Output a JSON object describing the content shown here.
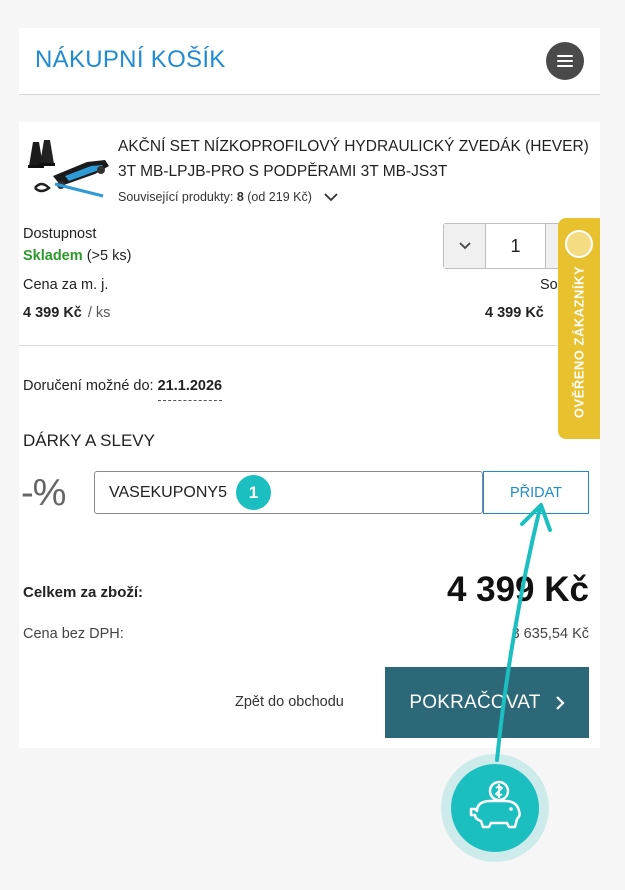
{
  "header": {
    "title": "NÁKUPNÍ KOŠÍK",
    "menu_icon": "hamburger-menu-icon"
  },
  "product": {
    "name": "AKČNÍ SET NÍZKOPROFILOVÝ HYDRAULICKÝ ZVEDÁK (HEVER) 3T MB-LPJB-PRO S PODPĚRAMI 3T MB-JS3T",
    "related_label": "Související produkty:",
    "related_count": "8",
    "related_price": "(od 219 Kč)",
    "availability_label": "Dostupnost",
    "stock_status": "Skladem",
    "stock_detail": "(>5 ks)",
    "unit_price_label": "Cena za m. j.",
    "unit_price": "4 399 Kč",
    "unit": "/ ks",
    "quantity": "1",
    "sum_label": "So",
    "sum_value": "4 399 Kč"
  },
  "delivery": {
    "label": "Doručení možné do:",
    "date": "21.1.2026"
  },
  "gifts": {
    "title": "DÁRKY A SLEVY",
    "percent_symbol": "-%",
    "coupon_value": "VASEKUPONY5",
    "add_label": "PŘIDAT"
  },
  "totals": {
    "total_label": "Celkem za zboží:",
    "total_value": "4 399 Kč",
    "vat_label": "Cena bez DPH:",
    "vat_value": "3 635,54 Kč"
  },
  "actions": {
    "back_label": "Zpět do obchodu",
    "continue_label": "POKRAČOVAT"
  },
  "verified_tab": {
    "label": "OVĚŘENO ZÁKAZNÍKY"
  },
  "overlay": {
    "step_number": "1",
    "accent_color": "#1bbfc0"
  },
  "colors": {
    "brand_blue": "#1f8bd3",
    "continue_bg": "#2c6878",
    "stock_green": "#2a9b2a",
    "verified_yellow": "#e8c12f"
  }
}
